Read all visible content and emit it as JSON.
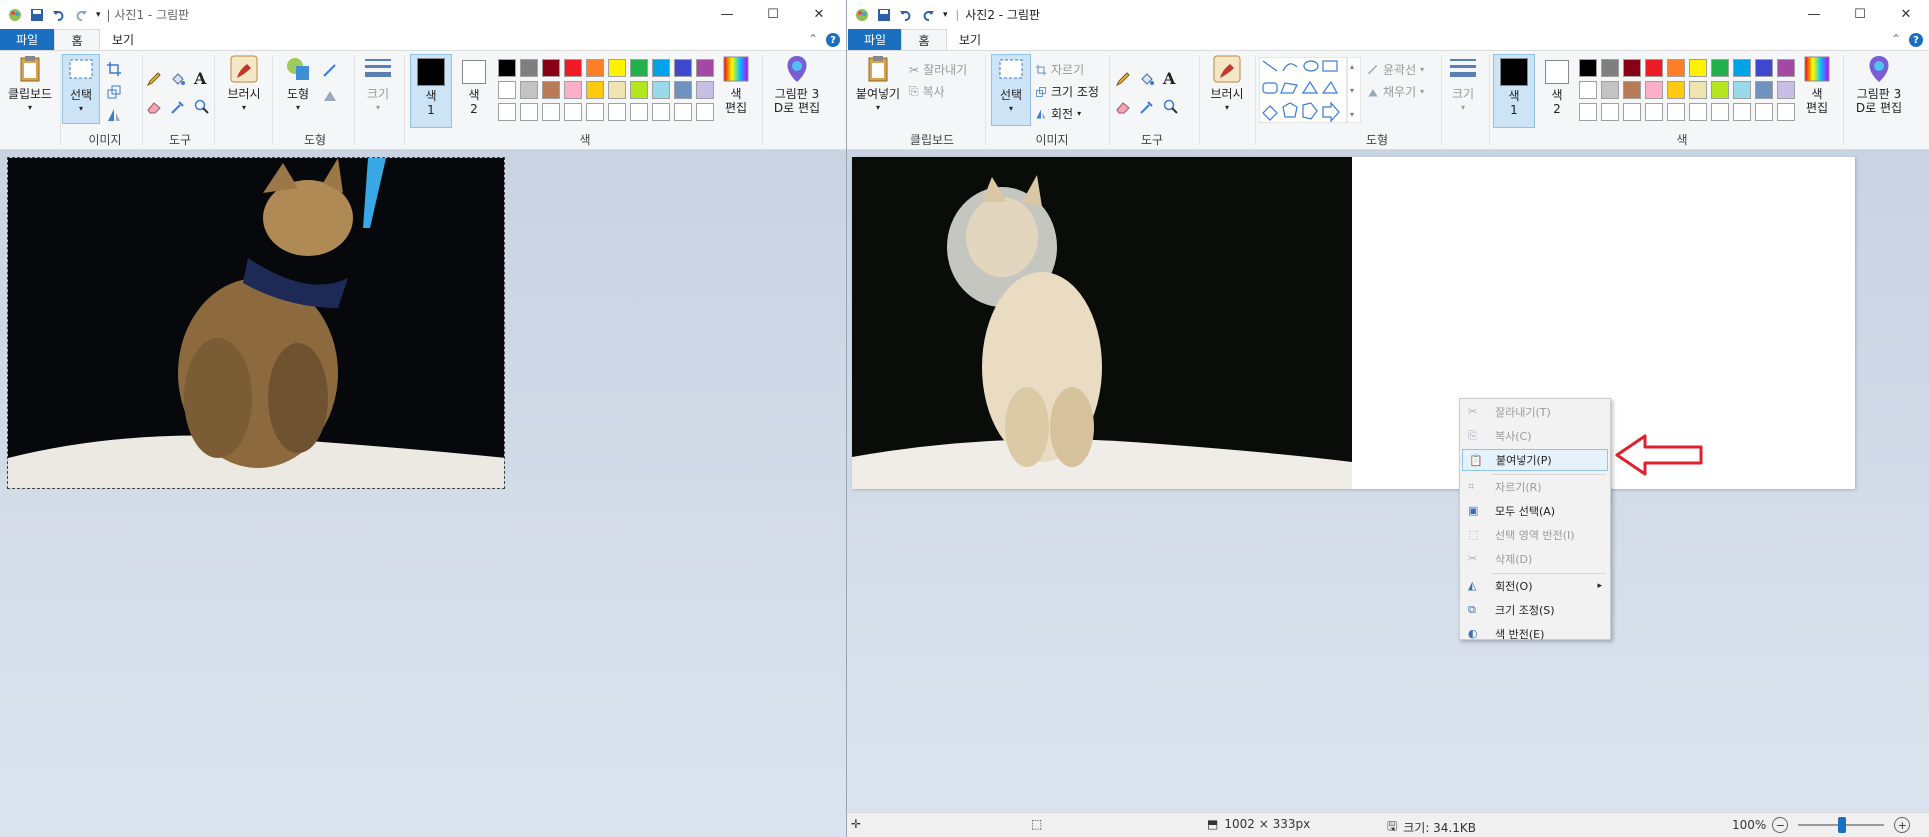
{
  "colors": {
    "file_tab": "#1a6fc1",
    "ribbon_bg": "#f5f6f7",
    "canvas_bg": "#c9d3e2",
    "arrow": "#e0202a"
  },
  "palette": [
    "#000000",
    "#7f7f7f",
    "#880015",
    "#ed1c24",
    "#ff7f27",
    "#fff200",
    "#22b14c",
    "#00a2e8",
    "#3f48cc",
    "#a349a4",
    "#ffffff",
    "#c3c3c3",
    "#b97a57",
    "#ffaec9",
    "#ffc90e",
    "#efe4b0",
    "#b5e61d",
    "#99d9ea",
    "#7092be",
    "#c8bfe7",
    "#ffffff",
    "#ffffff",
    "#ffffff",
    "#ffffff",
    "#ffffff",
    "#ffffff",
    "#ffffff",
    "#ffffff",
    "#ffffff",
    "#ffffff"
  ],
  "left": {
    "title": "| 사진1 - 그림판",
    "tabs": {
      "file": "파일",
      "home": "홈",
      "view": "보기"
    },
    "clipboard": {
      "label": "클립보드"
    },
    "image": {
      "select": "선택",
      "group": "이미지"
    },
    "tools": {
      "group": "도구"
    },
    "brushes": {
      "label": "브러시"
    },
    "shapes": {
      "label": "도형",
      "group": "도형"
    },
    "size": {
      "label": "크기"
    },
    "color1": {
      "line1": "색",
      "line2": "1"
    },
    "color2": {
      "line1": "색",
      "line2": "2"
    },
    "colors_group": "색",
    "edit_colors": {
      "line1": "색",
      "line2": "편집"
    },
    "paint3d": {
      "line1": "그림판 3",
      "line2": "D로 편집"
    }
  },
  "right": {
    "title": "사진2 - 그림판",
    "tabs": {
      "file": "파일",
      "home": "홈",
      "view": "보기"
    },
    "clipboard": {
      "paste": "붙여넣기",
      "cut": "잘라내기",
      "copy": "복사",
      "group": "클립보드"
    },
    "image": {
      "select": "선택",
      "crop": "자르기",
      "resize": "크기 조정",
      "rotate": "회전",
      "group": "이미지"
    },
    "tools": {
      "group": "도구"
    },
    "brushes": {
      "label": "브러시"
    },
    "shapes": {
      "outline": "윤곽선",
      "fill": "채우기",
      "group": "도형"
    },
    "size": {
      "label": "크기"
    },
    "color1": {
      "line1": "색",
      "line2": "1"
    },
    "color2": {
      "line1": "색",
      "line2": "2"
    },
    "colors_group": "색",
    "edit_colors": {
      "line1": "색",
      "line2": "편집"
    },
    "paint3d": {
      "line1": "그림판 3",
      "line2": "D로 편집"
    },
    "status": {
      "dimensions": "1002 × 333px",
      "size": "크기: 34.1KB",
      "zoom": "100%"
    }
  },
  "context_menu": {
    "items": [
      {
        "label": "잘라내기(T)",
        "icon": "scissors-icon",
        "enabled": false
      },
      {
        "label": "복사(C)",
        "icon": "copy-icon",
        "enabled": false
      },
      {
        "label": "붙여넣기(P)",
        "icon": "paste-icon",
        "enabled": true,
        "highlighted": true
      },
      {
        "label": "자르기(R)",
        "icon": "crop-icon",
        "enabled": false
      },
      {
        "label": "모두 선택(A)",
        "icon": "select-all-icon",
        "enabled": true
      },
      {
        "label": "선택 영역 반전(I)",
        "icon": "invert-selection-icon",
        "enabled": false
      },
      {
        "label": "삭제(D)",
        "icon": "delete-icon",
        "enabled": false
      },
      {
        "label": "회전(O)",
        "icon": "rotate-icon",
        "enabled": true,
        "submenu": true
      },
      {
        "label": "크기 조정(S)",
        "icon": "resize-icon",
        "enabled": true
      },
      {
        "label": "색 반전(E)",
        "icon": "invert-color-icon",
        "enabled": true
      }
    ]
  }
}
